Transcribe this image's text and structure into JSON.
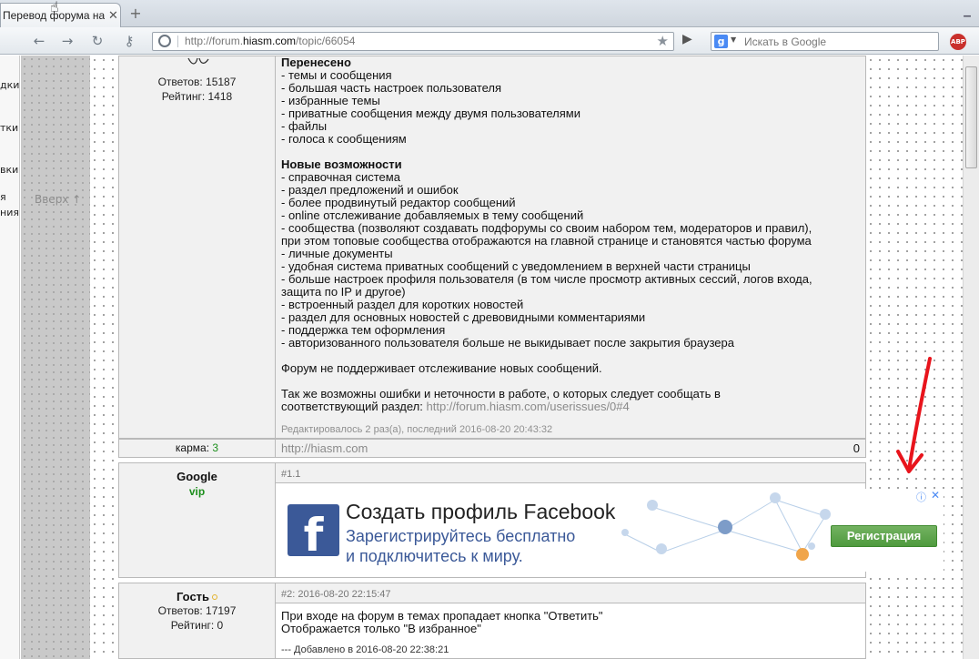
{
  "browser": {
    "tab_title": "Перевод форума на но...",
    "tab_close": "✕",
    "new_tab": "+",
    "url_prefix": "http://forum.",
    "url_domain": "hiasm.com",
    "url_suffix": "/topic/66054",
    "search_placeholder": "Искать в Google",
    "search_engine": "g",
    "abp": "ABP"
  },
  "left_panel": {
    "items": [
      "дки",
      "тки",
      "вки",
      "я",
      "ния"
    ]
  },
  "up_link": "Вверх ↑",
  "post0": {
    "stats": {
      "replies": "Ответов: 15187",
      "rating": "Рейтинг: 1418"
    },
    "lines": [
      {
        "t": "Перенесено",
        "h": true
      },
      {
        "t": "- темы и сообщения"
      },
      {
        "t": "- большая часть настроек пользователя"
      },
      {
        "t": "- избранные темы"
      },
      {
        "t": "- приватные сообщения между двумя пользователями"
      },
      {
        "t": "- файлы"
      },
      {
        "t": "- голоса к сообщениям"
      },
      {
        "t": ""
      },
      {
        "t": "Новые возможности",
        "h": true
      },
      {
        "t": "- справочная система"
      },
      {
        "t": "- раздел предложений и ошибок"
      },
      {
        "t": "- более продвинутый редактор сообщений"
      },
      {
        "t": "- online отслеживание добавляемых в тему сообщений"
      },
      {
        "t": "- сообщества (позволяют создавать подфорумы со своим набором тем, модераторов и правил),"
      },
      {
        "t": "при этом топовые сообщества отображаются на главной странице и становятся частью форума"
      },
      {
        "t": "- личные документы"
      },
      {
        "t": "- удобная система приватных сообщений с уведомлением в верхней части страницы"
      },
      {
        "t": "- больше настроек профиля пользователя (в том числе просмотр активных сессий, логов входа,"
      },
      {
        "t": "защита по IP и другое)"
      },
      {
        "t": "- встроенный раздел для коротких новостей"
      },
      {
        "t": "- раздел для основных новостей с древовидными комментариями"
      },
      {
        "t": "- поддержка тем оформления"
      },
      {
        "t": "- авторизованного пользователя больше не выкидывает после закрытия браузера"
      },
      {
        "t": ""
      },
      {
        "t": "Форум не поддерживает отслеживание новых сообщений."
      },
      {
        "t": ""
      },
      {
        "t": "Так же возможны ошибки и неточности в работе, о которых следует сообщать в"
      },
      {
        "t": "соответствующий раздел: ",
        "link": "http://forum.hiasm.com/userissues/0#4"
      }
    ],
    "edited": "Редактировалось 2 раз(а), последний 2016-08-20 20:43:32",
    "karma_label": "карма: ",
    "karma_value": "3",
    "signature": "http://hiasm.com",
    "vote_count": "0"
  },
  "post1": {
    "author": "Google",
    "badge": "vip",
    "meta": "#1.1"
  },
  "ad": {
    "logo": "f",
    "title": "Создать профиль Facebook",
    "subtitle_1": "Зарегистрируйтесь бесплатно",
    "subtitle_2": "и подключитесь к миру.",
    "button": "Регистрация",
    "info": "ⓘ",
    "close": "✕"
  },
  "post2": {
    "author": "Гость",
    "replies": "Ответов: 17197",
    "rating": "Рейтинг: 0",
    "meta": "#2: 2016-08-20 22:15:47",
    "lines": [
      "При входе на форум в темах пропадает кнопка \"Ответить\"",
      "Отображается только \"В избранное\""
    ],
    "added": "--- Добавлено в 2016-08-20 22:38:21"
  },
  "colors": {
    "annotation_arrow": "#e8141c",
    "fb_blue": "#3b5998",
    "karma_green": "#1d8f1d"
  }
}
